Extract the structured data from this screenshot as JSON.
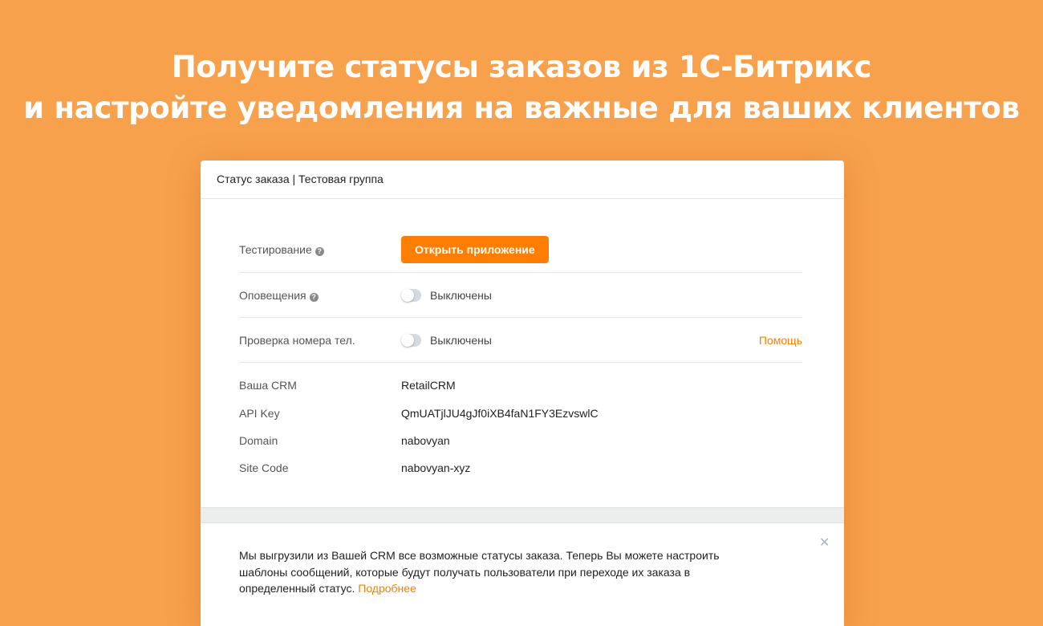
{
  "headline": {
    "line1": "Получите статусы заказов из 1С-Битрикс",
    "line2": "и настройте уведомления на важные для ваших клиентов"
  },
  "card": {
    "title": "Статус заказа | Тестовая группа",
    "testing": {
      "label": "Тестирование",
      "button": "Открыть приложение"
    },
    "notifications": {
      "label": "Оповещения",
      "state": "Выключены",
      "enabled": false
    },
    "phone_check": {
      "label": "Проверка номера тел.",
      "state": "Выключены",
      "enabled": false,
      "help_link": "Помощь"
    },
    "info": [
      {
        "label": "Ваша CRM",
        "value": "RetailCRM"
      },
      {
        "label": "API Key",
        "value": "QmUATjlJU4gJf0iXB4faN1FY3EzvswlC"
      },
      {
        "label": "Domain",
        "value": "nabovyan"
      },
      {
        "label": "Site Code",
        "value": "nabovyan-xyz"
      }
    ],
    "notice": {
      "text": "Мы выгрузили из Вашей CRM все возможные статусы заказа. Теперь Вы можете настроить шаблоны сообщений, которые будут получать пользователи при переходе их заказа в определенный статус.",
      "link": "Подробнее"
    }
  },
  "colors": {
    "background": "#F7A14D",
    "accent": "#FF7D00"
  }
}
